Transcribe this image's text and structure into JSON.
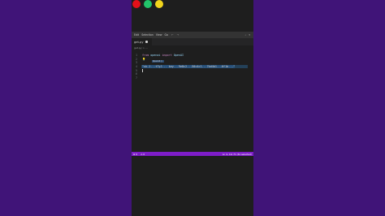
{
  "colors": {
    "background": "#401478",
    "editor_bg": "#1e1e1e",
    "statusbar": "#7e1dc8"
  },
  "window_controls": [
    "close-dot",
    "minimize-dot",
    "maximize-dot"
  ],
  "menu": [
    "Edit",
    "Selection",
    "View",
    "Go"
  ],
  "nav": {
    "back": "←",
    "forward": "→"
  },
  "titlebar_right": [
    "⌕",
    "▾"
  ],
  "tab": {
    "label": "get.py"
  },
  "breadcrumb": "get.py > ...",
  "editor": {
    "line_numbers": [
      "1",
      "2",
      "3",
      "4",
      "5",
      "6",
      "7"
    ],
    "line1": {
      "kw1": "from",
      "module": "openai",
      "kw2": "import",
      "name": "OpenAI"
    },
    "line2_icon": "💡",
    "hint": "OpenAI()",
    "line4_text": "\"sk-1...t7yJ... key...9e8c2...50c4c1...7bd4b1...6f1b...\""
  },
  "status": {
    "errors": "⊗ 0",
    "warnings": "⚠ 0",
    "position": "Ln 4, Col 71 (61 selected)"
  }
}
